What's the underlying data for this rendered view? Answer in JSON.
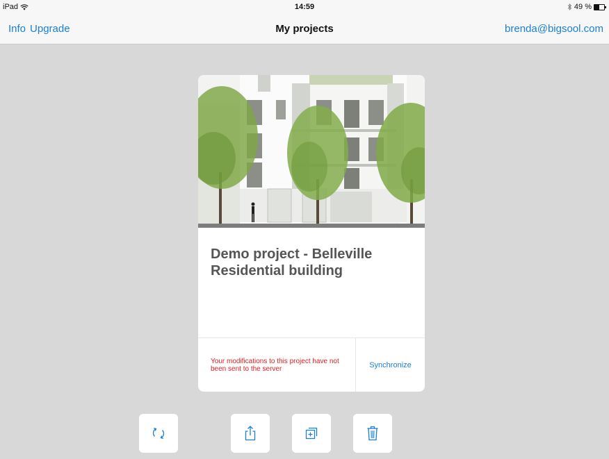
{
  "status_bar": {
    "device": "iPad",
    "time": "14:59",
    "battery": "49 %",
    "battery_level": 0.49
  },
  "nav": {
    "info_label": "Info",
    "upgrade_label": "Upgrade",
    "title": "My projects",
    "account": "brenda@bigsool.com"
  },
  "project": {
    "title": "Demo project - Belleville Residential building",
    "warning": "Your modifications to this project have not been sent to the server",
    "sync_label": "Synchronize"
  },
  "toolbar": {
    "icons": [
      "refresh-icon",
      "share-icon",
      "duplicate-icon",
      "trash-icon"
    ]
  },
  "colors": {
    "accent": "#1a7fd4",
    "warning": "#e02020",
    "background": "#d8d8d8",
    "title_text": "#555555"
  }
}
